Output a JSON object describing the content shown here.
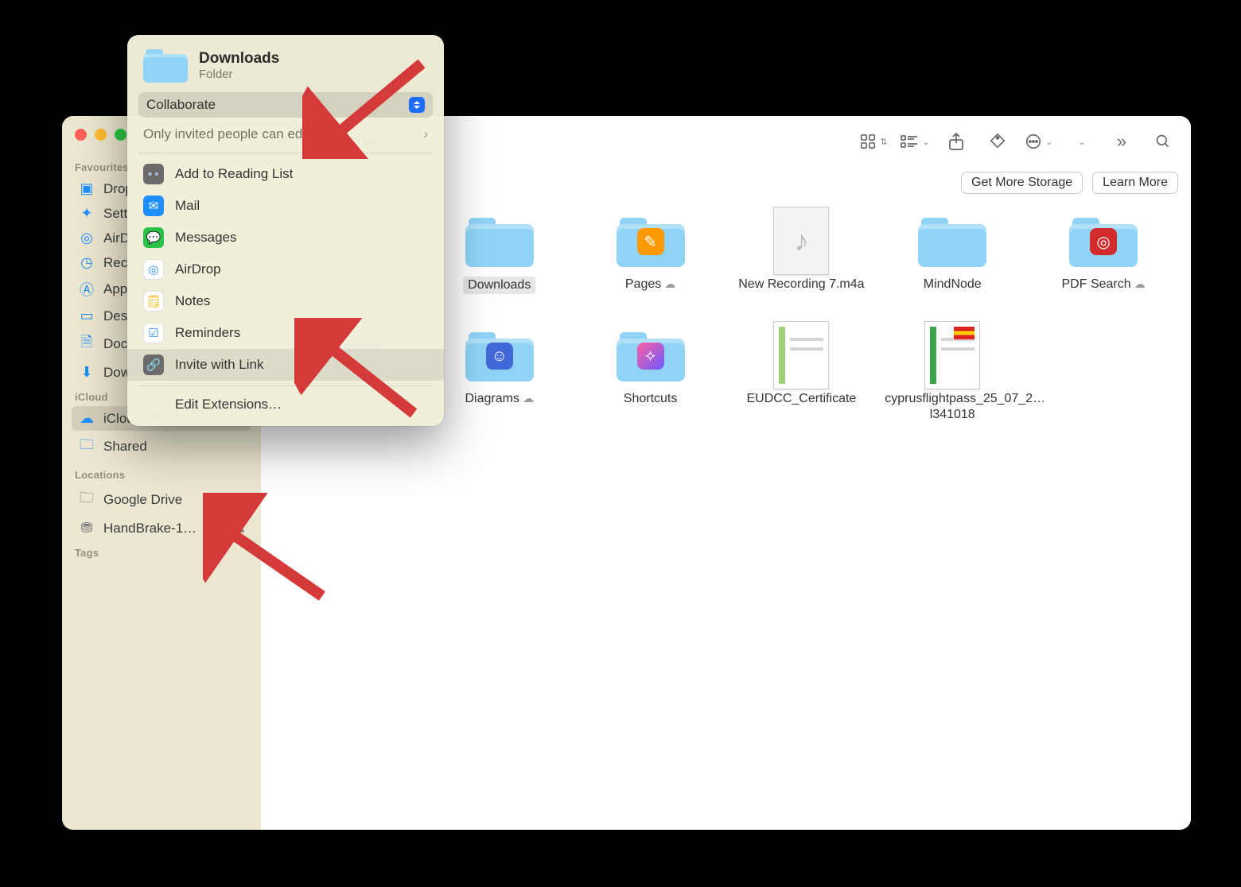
{
  "window": {
    "title": "iCloud Drive"
  },
  "banner": {
    "text": "Your iCloud storage is full",
    "get_more": "Get More Storage",
    "learn_more": "Learn More"
  },
  "sidebar": {
    "favourites_label": "Favourites",
    "icloud_label": "iCloud",
    "locations_label": "Locations",
    "tags_label": "Tags",
    "favourites": [
      {
        "label": "Dropbox"
      },
      {
        "label": "Settings"
      },
      {
        "label": "AirDrop"
      },
      {
        "label": "Recents"
      },
      {
        "label": "Applications"
      },
      {
        "label": "Desktop"
      },
      {
        "label": "Documents"
      },
      {
        "label": "Downloads"
      }
    ],
    "icloud": [
      {
        "label": "iCloud Drive"
      },
      {
        "label": "Shared"
      }
    ],
    "locations": [
      {
        "label": "Google Drive"
      },
      {
        "label": "HandBrake-1…"
      }
    ]
  },
  "items": {
    "downloads": "Downloads",
    "pages": "Pages",
    "new_recording": "New Recording 7.m4a",
    "mindnode": "MindNode",
    "pdf_search": "PDF Search",
    "automator": "Automator",
    "diagrams": "Diagrams",
    "shortcuts": "Shortcuts",
    "eudcc": "EUDCC_Certificate",
    "cyprus": "cyprusflightpass_25_07_2…l341018"
  },
  "popover": {
    "title": "Downloads",
    "subtitle": "Folder",
    "mode": "Collaborate",
    "permission": "Only invited people can edit.",
    "apps": {
      "reading_list": "Add to Reading List",
      "mail": "Mail",
      "messages": "Messages",
      "airdrop": "AirDrop",
      "notes": "Notes",
      "reminders": "Reminders",
      "invite_link": "Invite with Link"
    },
    "edit_ext": "Edit Extensions…"
  }
}
